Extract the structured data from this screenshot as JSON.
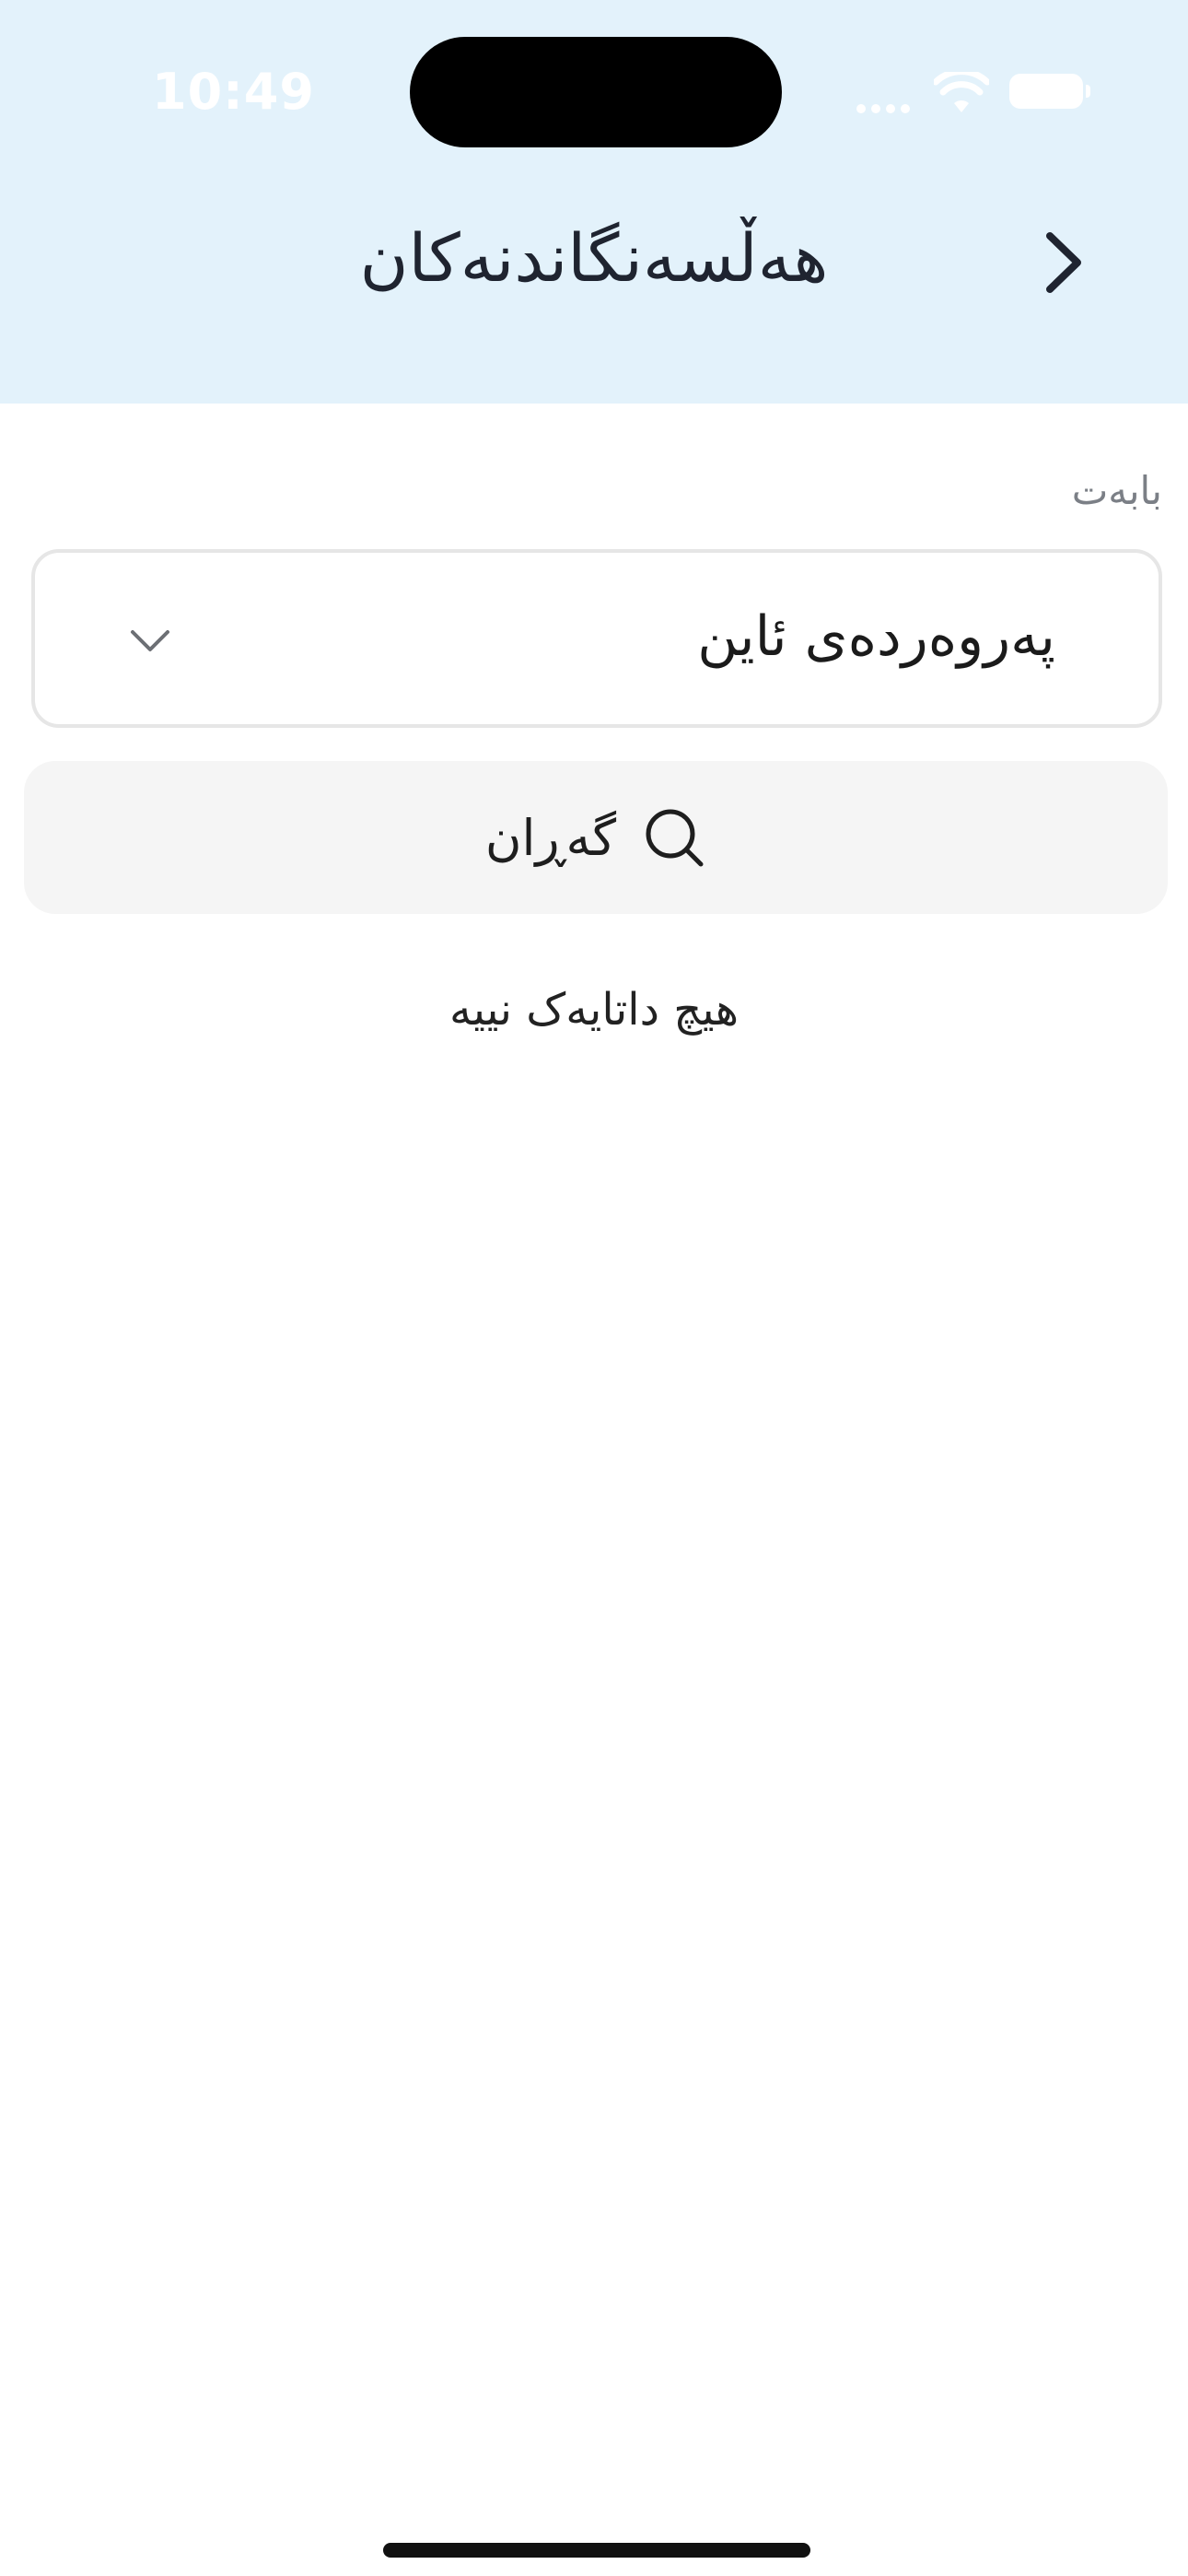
{
  "status_bar": {
    "time": "10:49"
  },
  "header": {
    "title": "هەڵسەنگاندنەکان",
    "back_icon": "chevron-right-icon",
    "background": "#e3f2fb"
  },
  "subject_field": {
    "label": "بابەت",
    "selected_value": "پەروەردەی ئاین",
    "dropdown_icon": "chevron-down-icon"
  },
  "search": {
    "label": "گەڕان",
    "icon": "search-icon"
  },
  "empty_state": {
    "message": "هیچ داتایەک نییە"
  }
}
